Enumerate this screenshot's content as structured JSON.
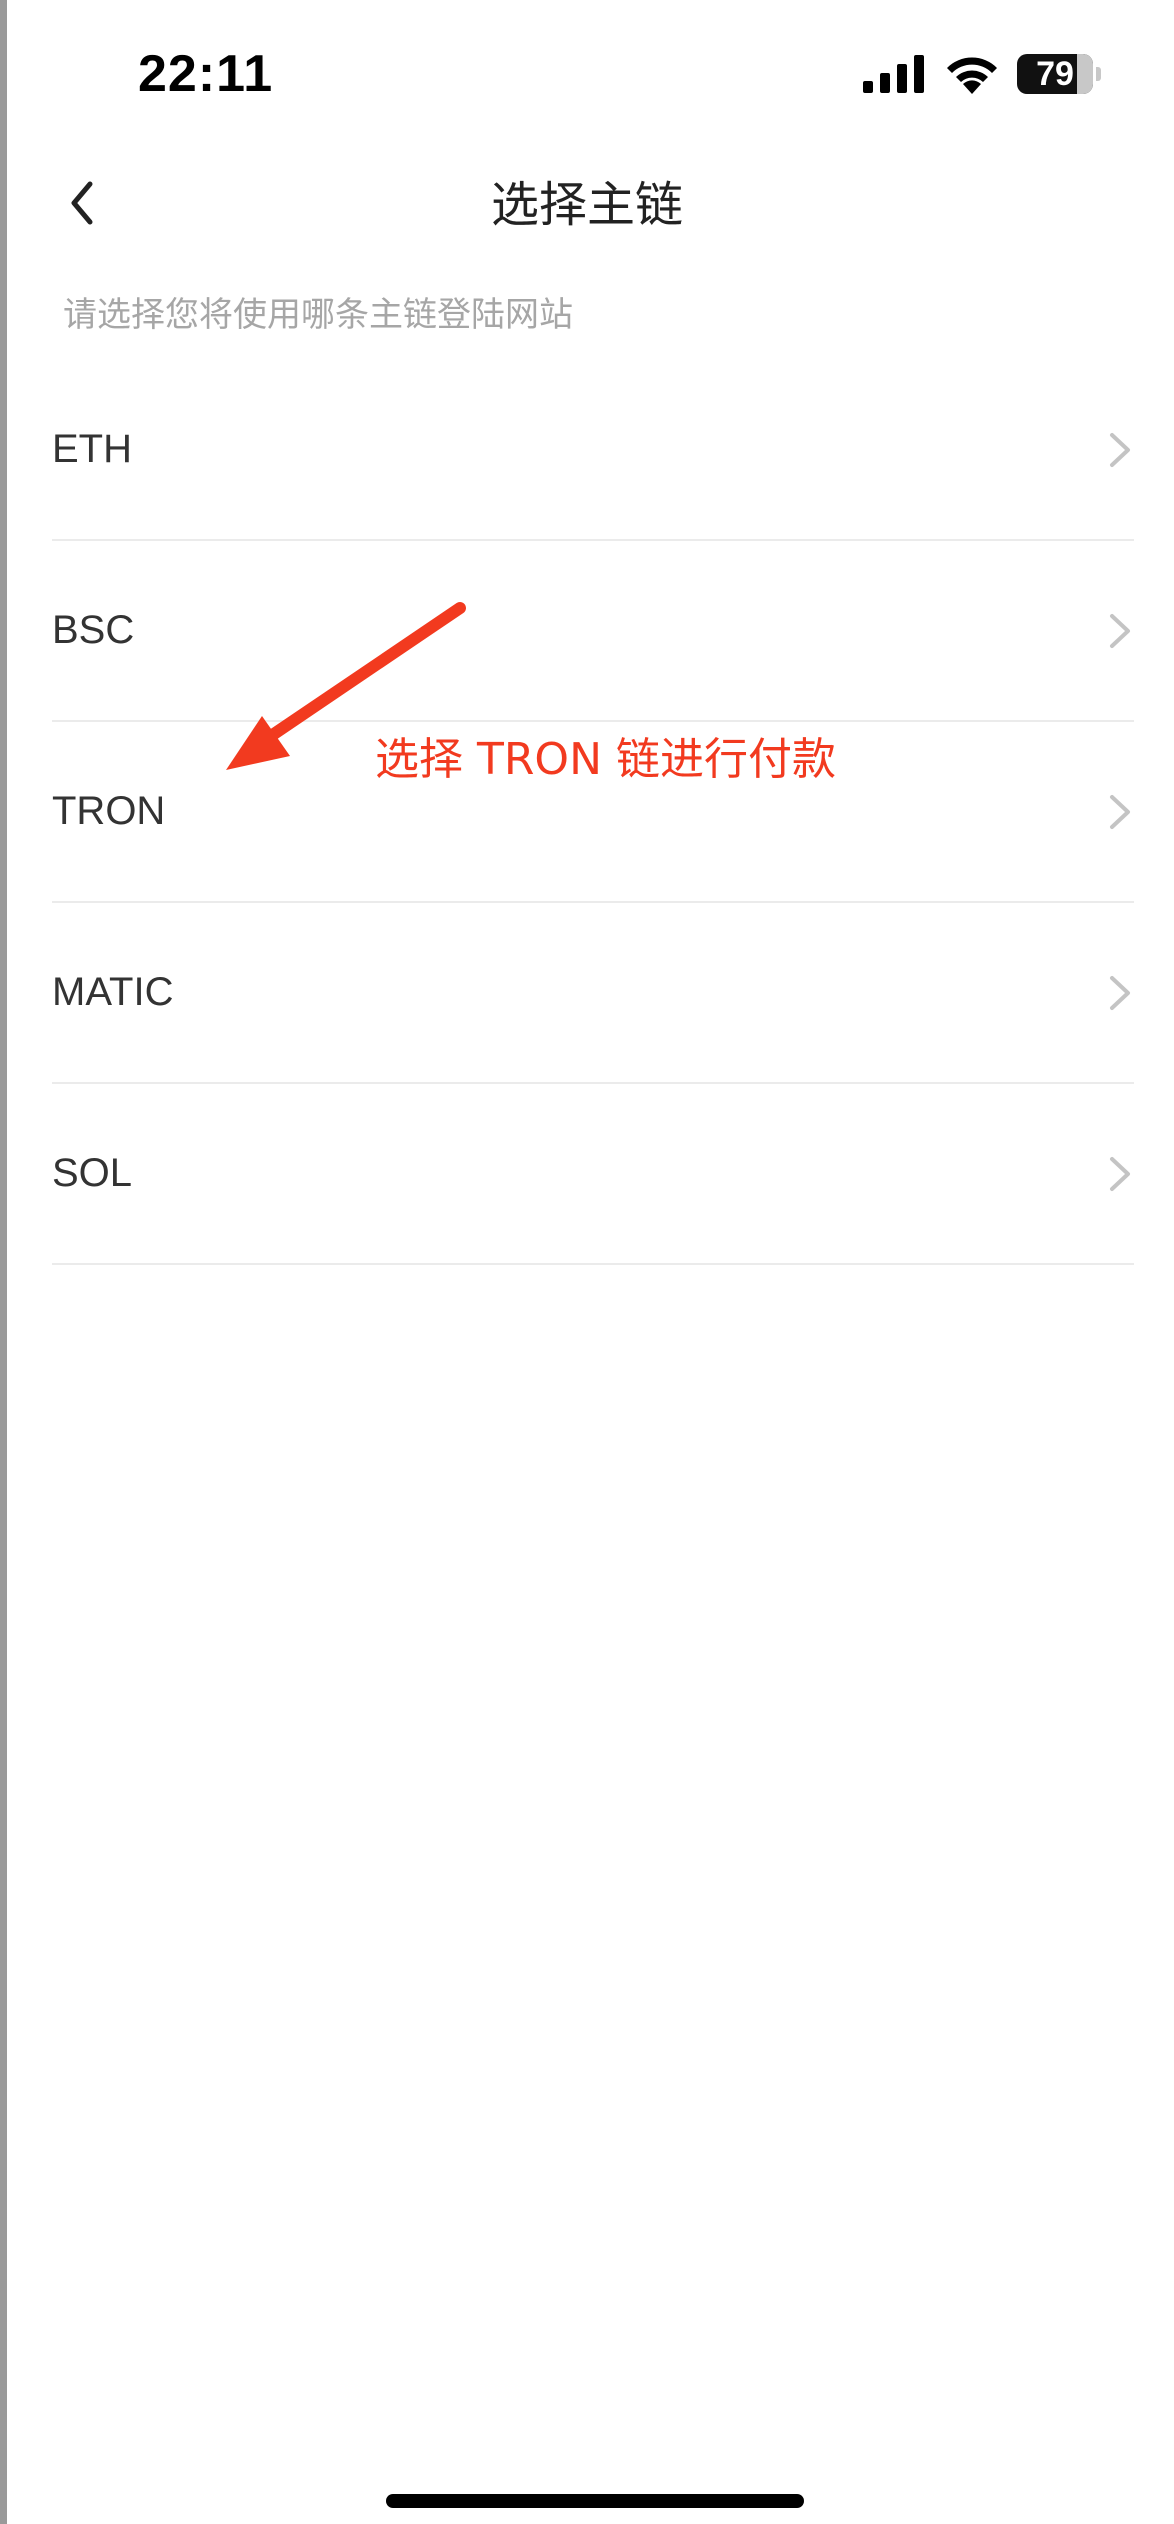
{
  "status_bar": {
    "time": "22:11",
    "battery_level": "79",
    "icons": [
      "cellular-signal-icon",
      "wifi-icon",
      "battery-icon"
    ]
  },
  "nav": {
    "back_icon": "chevron-left-icon",
    "title": "选择主链"
  },
  "subtitle": "请选择您将使用哪条主链登陆网站",
  "chains": [
    {
      "label": "ETH",
      "icon": "chevron-right-icon"
    },
    {
      "label": "BSC",
      "icon": "chevron-right-icon"
    },
    {
      "label": "TRON",
      "icon": "chevron-right-icon"
    },
    {
      "label": "MATIC",
      "icon": "chevron-right-icon"
    },
    {
      "label": "SOL",
      "icon": "chevron-right-icon"
    }
  ],
  "annotation": {
    "text": "选择 TRON 链进行付款",
    "color": "#f23a1f",
    "icon": "red-arrow-icon"
  }
}
